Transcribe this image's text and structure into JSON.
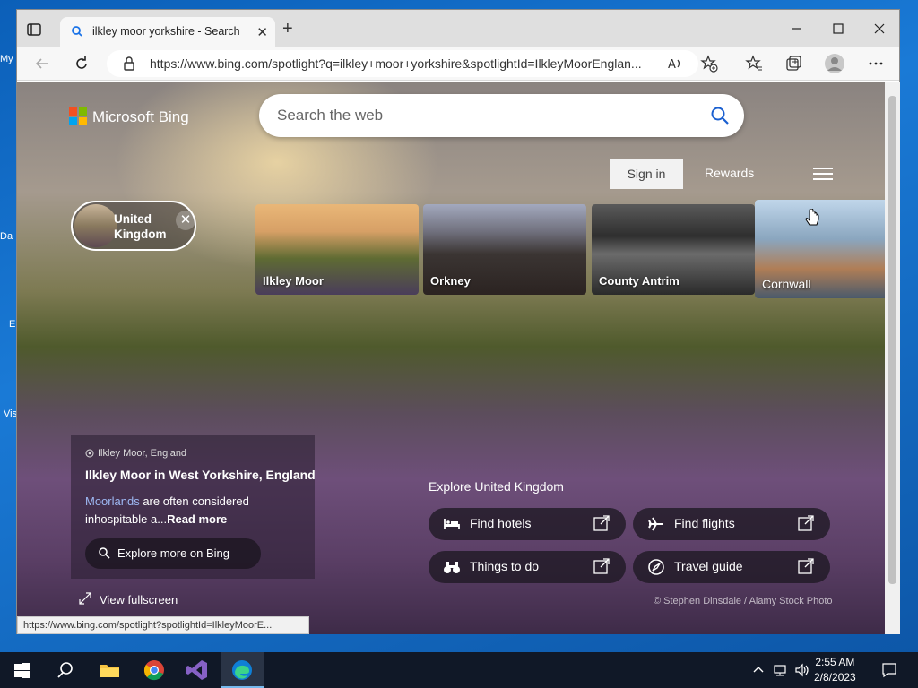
{
  "desktop": {
    "labels": [
      "My",
      "Da",
      "E",
      "Vis"
    ]
  },
  "browser": {
    "tab_title": "ilkley moor yorkshire - Search",
    "new_tab_label": "+",
    "address_url": "https://www.bing.com/spotlight?q=ilkley+moor+yorkshire&spotlightId=IlkleyMoorEnglan...",
    "status_url": "https://www.bing.com/spotlight?spotlightId=IlkleyMoorE..."
  },
  "bing": {
    "logo_text": "Microsoft Bing",
    "search_placeholder": "Search the web",
    "signin_label": "Sign in",
    "rewards_label": "Rewards",
    "region_label": "United Kingdom",
    "region_close": "✕",
    "cards": [
      "Ilkley Moor",
      "Orkney",
      "County Antrim",
      "Cornwall"
    ],
    "info": {
      "location": "Ilkley Moor, England",
      "title": "Ilkley Moor in West Yorkshire, England",
      "desc_link": "Moorlands",
      "desc_text": " are often considered inhospitable a...",
      "read_more": "Read more",
      "explore_more": "Explore more on Bing"
    },
    "view_fullscreen": "View fullscreen",
    "explore_heading": "Explore United Kingdom",
    "actions": [
      "Find hotels",
      "Find flights",
      "Things to do",
      "Travel guide"
    ],
    "credit": "© Stephen Dinsdale / Alamy Stock Photo"
  },
  "taskbar": {
    "time": "2:55 AM",
    "date": "2/8/2023"
  },
  "colors": {
    "accent_link": "#9db8f2",
    "taskbar_bg": "#101827",
    "edge_blue": "#0f7fd6"
  }
}
